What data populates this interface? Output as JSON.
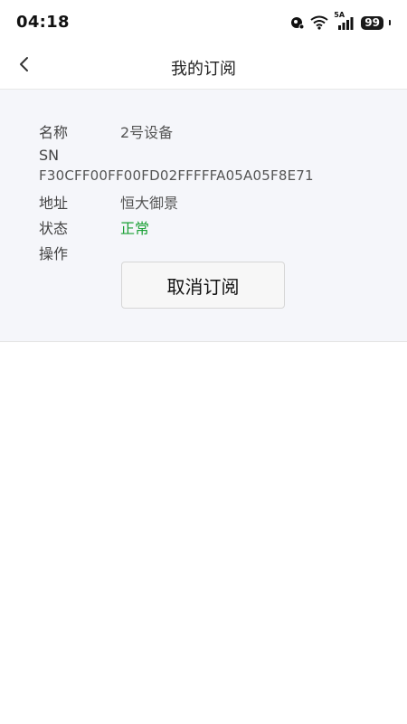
{
  "status_bar": {
    "time": "04:18",
    "network_label": "5A",
    "battery_level": "99"
  },
  "header": {
    "title": "我的订阅"
  },
  "device": {
    "name_label": "名称",
    "name_value": "2号设备",
    "sn_label": "SN",
    "sn_value": "F30CFF00FF00FD02FFFFFA05A05F8E71",
    "address_label": "地址",
    "address_value": "恒大御景",
    "status_label": "状态",
    "status_value": "正常",
    "status_color": "#1aa035",
    "action_label": "操作",
    "cancel_button_label": "取消订阅"
  }
}
